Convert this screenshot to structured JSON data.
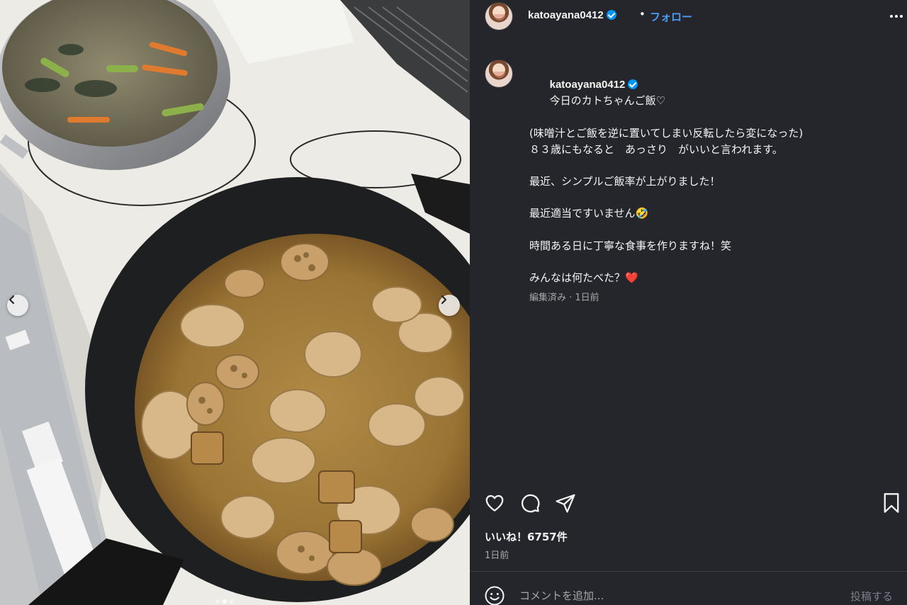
{
  "post": {
    "username": "katoayana0412",
    "header_separator": "•",
    "follow_label": "フォロー",
    "caption_lines": [
      "今日のカトちゃんご飯♡",
      "(味噌汁とご飯を逆に置いてしまい反転したら変になった)",
      "８３歳にもなると　あっさり　がいいと言われます。",
      "最近、シンプルご飯率が上がりました！",
      "最近適当ですいません🤣",
      "時間ある日に丁寧な食事を作りますね！笑",
      "みんなは何たべた？❤️"
    ],
    "caption_meta": "編集済み · 1日前",
    "likes": "いいね！6757件",
    "time": "1日前"
  },
  "comment": {
    "placeholder": "コメントを追加...",
    "post_label": "投稿する"
  },
  "carousel": {
    "slide_count": 3,
    "active_index": 1
  },
  "colors": {
    "panel_bg": "#25262b",
    "accent": "#4a9bf5",
    "verified": "#0095f6",
    "muted_text": "#a8a8a8",
    "post_button": "#7c7f88"
  },
  "icons": {
    "like": "heart-icon",
    "comment": "speech-bubble-icon",
    "share": "paper-plane-icon",
    "save": "bookmark-icon",
    "emoji": "smiley-icon",
    "more": "ellipsis-icon",
    "prev": "chevron-left-icon",
    "next": "chevron-right-icon",
    "verified": "verified-badge-icon"
  }
}
